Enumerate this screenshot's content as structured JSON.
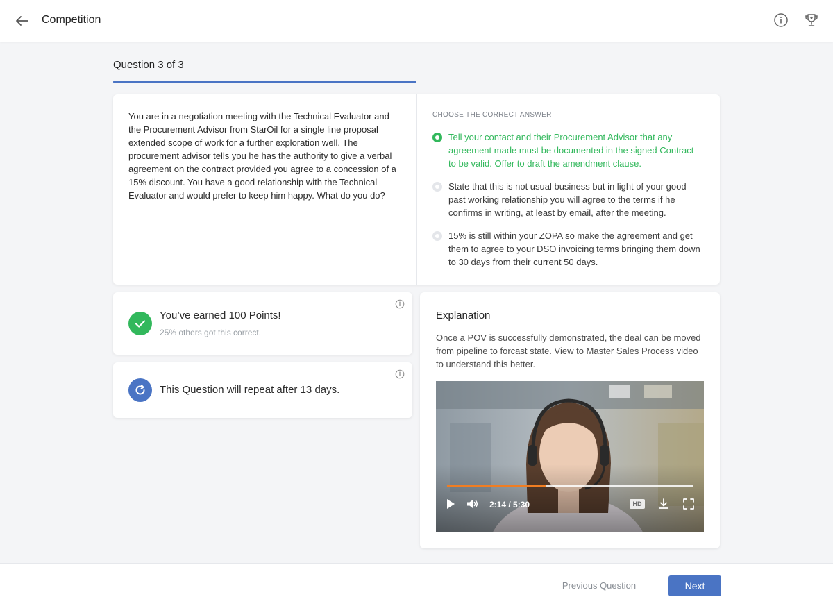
{
  "header": {
    "title": "Competition",
    "back_icon": "arrow-left-icon",
    "info_icon": "info-icon",
    "trophy_icon": "trophy-icon"
  },
  "question": {
    "label": "Question 3 of 3",
    "progress": 1.0,
    "text": "You are in a negotiation meeting with the Technical Evaluator and the Procurement Advisor from StarOil for a single line proposal extended scope of work for a further exploration well. The procurement advisor tells you he has the authority to give a verbal agreement on the contract provided you agree to a concession of a 15% discount. You have a good relationship with the Technical Evaluator and would prefer to keep him happy. What do you do?"
  },
  "answers": {
    "header": "CHOOSE THE CORRECT ANSWER",
    "options": [
      {
        "text": "Tell your contact and their Procurement Advisor that any agreement made must be documented in the signed Contract to be valid. Offer to draft the amendment clause.",
        "selected": true
      },
      {
        "text": "State that this is not usual business but in light of your good past working relationship you will agree to the terms if he confirms in writing, at least by email, after the meeting.",
        "selected": false
      },
      {
        "text": "15% is still within your ZOPA so make the agreement and get them to agree to your DSO invoicing terms bringing them down to 30 days from their current 50 days.",
        "selected": false
      }
    ]
  },
  "result": {
    "points_title": "You’ve earned 100 Points!",
    "points_sub": "25% others got this correct.",
    "repeat_text": "This Question will repeat after 13 days."
  },
  "explanation": {
    "title": "Explanation",
    "text": "Once a POV is successfully demonstrated, the deal can be moved from pipeline to forcast state. View to Master Sales Process video to understand this better.",
    "video": {
      "time": "2:14 / 5:30",
      "progress": 0.405,
      "hd_label": "HD"
    }
  },
  "footer": {
    "prev_label": "Previous Question",
    "next_label": "Next"
  },
  "colors": {
    "accent": "#4a74c4",
    "correct": "#32b85c",
    "video_progress": "#f07d22"
  }
}
